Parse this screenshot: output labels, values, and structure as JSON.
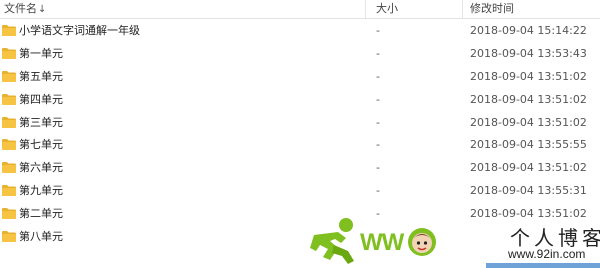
{
  "header": {
    "name_label": "文件名",
    "sort_arrow": "↓",
    "size_label": "大小",
    "date_label": "修改时间"
  },
  "rows": [
    {
      "name": "小学语文字词通解一年级",
      "size": "-",
      "date": "2018-09-04 15:14:22"
    },
    {
      "name": "第一单元",
      "size": "-",
      "date": "2018-09-04 13:53:43"
    },
    {
      "name": "第五单元",
      "size": "-",
      "date": "2018-09-04 13:51:02"
    },
    {
      "name": "第四单元",
      "size": "-",
      "date": "2018-09-04 13:51:02"
    },
    {
      "name": "第三单元",
      "size": "-",
      "date": "2018-09-04 13:51:02"
    },
    {
      "name": "第七单元",
      "size": "-",
      "date": "2018-09-04 13:55:55"
    },
    {
      "name": "第六单元",
      "size": "-",
      "date": "2018-09-04 13:51:02"
    },
    {
      "name": "第九单元",
      "size": "-",
      "date": "2018-09-04 13:55:31"
    },
    {
      "name": "第二单元",
      "size": "-",
      "date": "2018-09-04 13:51:02"
    },
    {
      "name": "第八单元",
      "size": "",
      "date": ""
    }
  ],
  "icons": {
    "row_icon": "folder-icon"
  },
  "colors": {
    "folder": "#f6c343",
    "folder_tab": "#e8b22f",
    "watermark_green": "#7fbf1f"
  },
  "watermark": {
    "letters": "WW",
    "title": "个人博客",
    "url": "www.92in.com"
  }
}
